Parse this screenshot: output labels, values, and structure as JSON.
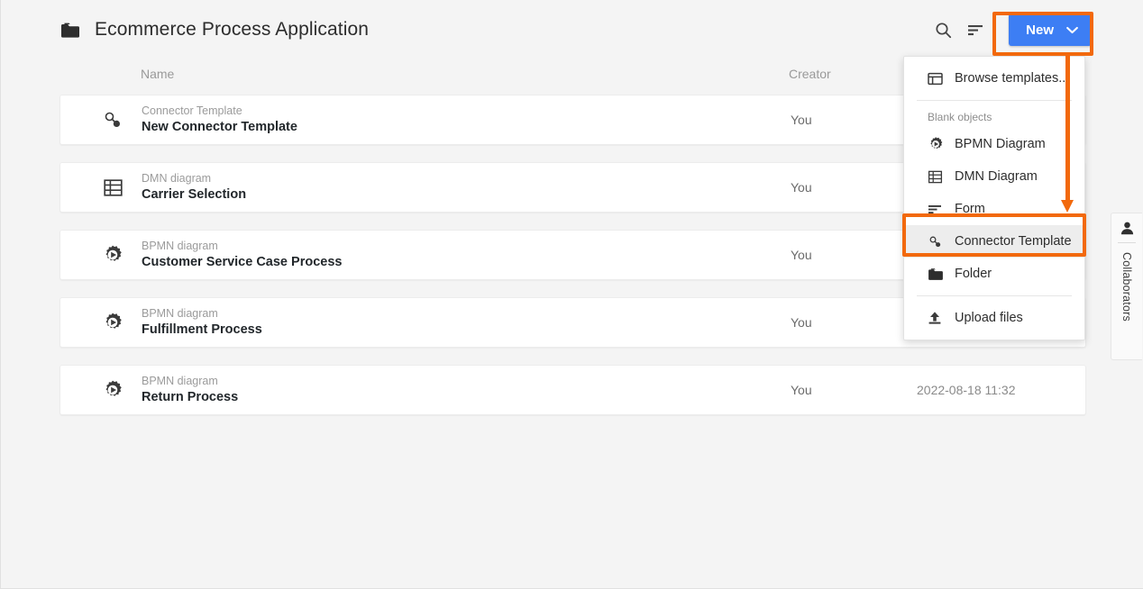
{
  "header": {
    "folder_icon": "folder-icon",
    "title": "Ecommerce Process Application",
    "search_icon": "search-icon",
    "sort_icon": "sort-icon",
    "new_label": "New",
    "new_caret_icon": "chevron-down-icon"
  },
  "columns": {
    "name": "Name",
    "creator": "Creator"
  },
  "rows": [
    {
      "icon": "connector-template-icon",
      "type": "Connector Template",
      "name": "New Connector Template",
      "creator": "You",
      "date": ""
    },
    {
      "icon": "dmn-table-icon",
      "type": "DMN diagram",
      "name": "Carrier Selection",
      "creator": "You",
      "date": ""
    },
    {
      "icon": "bpmn-gear-icon",
      "type": "BPMN diagram",
      "name": "Customer Service Case Process",
      "creator": "You",
      "date": ""
    },
    {
      "icon": "bpmn-gear-icon",
      "type": "BPMN diagram",
      "name": "Fulfillment Process",
      "creator": "You",
      "date": ""
    },
    {
      "icon": "bpmn-gear-icon",
      "type": "BPMN diagram",
      "name": "Return Process",
      "creator": "You",
      "date": "2022-08-18 11:32"
    }
  ],
  "menu": {
    "browse_templates": "Browse templates...",
    "group_label": "Blank objects",
    "items": [
      {
        "label": "BPMN Diagram",
        "icon": "bpmn-gear-icon"
      },
      {
        "label": "DMN Diagram",
        "icon": "dmn-table-icon"
      },
      {
        "label": "Form",
        "icon": "form-lines-icon"
      },
      {
        "label": "Connector Template",
        "icon": "connector-template-icon"
      }
    ],
    "folder": "Folder",
    "upload_files": "Upload files"
  },
  "collaborators": {
    "label": "Collaborators",
    "icon": "person-icon"
  },
  "colors": {
    "accent_blue": "#3d7ef4",
    "highlight_orange": "#f2690d",
    "page_bg": "#f4f4f4",
    "card_bg": "#ffffff",
    "text_primary": "#22272b",
    "text_muted": "#9b9b9b"
  }
}
